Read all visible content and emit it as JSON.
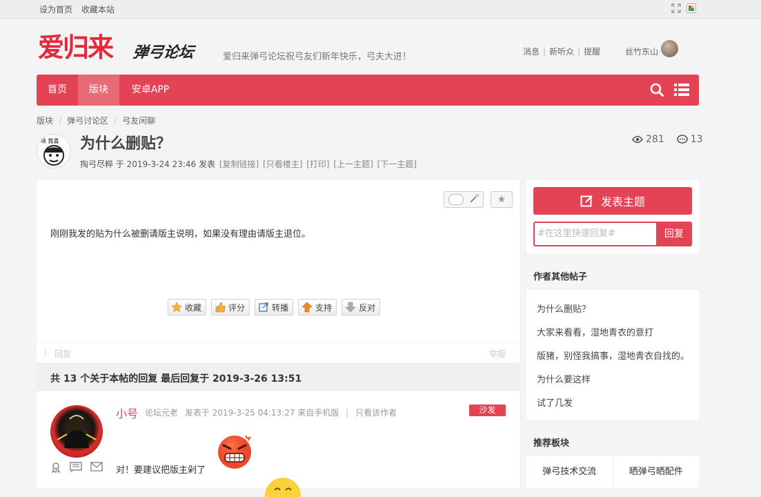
{
  "topbar": {
    "links": [
      "设为首页",
      "收藏本站"
    ]
  },
  "header": {
    "logo_big": "爱归来",
    "logo_script": "弹弓论坛",
    "slogan": "爱归来弹弓论坛祝弓友们新年快乐，弓夫大进！",
    "user_links": [
      "消息",
      "新听众",
      "提醒"
    ],
    "username": "丝竹东山"
  },
  "nav": {
    "items": [
      "首页",
      "版块",
      "安卓APP"
    ],
    "active_index": 1
  },
  "breadcrumb": [
    "版块",
    "弹弓讨论区",
    "弓友闲聊"
  ],
  "thread": {
    "title": "为什么删贴？",
    "author": "掏弓尽粹",
    "posted": "于 2019-3-24 23:46 发表",
    "meta_links": [
      "[复制链接]",
      "[只看楼主]",
      "[打印]",
      "[上一主题]",
      "[下一主题]"
    ],
    "views": "281",
    "replies": "13"
  },
  "post": {
    "body": "刚刚我发的贴为什么被删请版主说明，如果没有理由请版主退位。",
    "actions": [
      "收藏",
      "评分",
      "转播",
      "支持",
      "反对"
    ],
    "foot_reply": "回复",
    "foot_report": "举报"
  },
  "reply_summary": "共 13 个关于本帖的回复 最后回复于 2019-3-26 13:51",
  "reply": {
    "name": "小号",
    "rank": "论坛元老",
    "posted": "发表于 2019-3-25 04:13:27 来自手机版",
    "only_author": "只看该作者",
    "badge": "沙发",
    "text": "对！要建议把版主剁了"
  },
  "sidebar": {
    "new_thread": "发表主题",
    "quick_placeholder": "#在这里快速回复#",
    "quick_button": "回复",
    "other_posts_title": "作者其他帖子",
    "other_posts": [
      "为什么删贴？",
      "大家来看看，湿地青衣的意打",
      "版猪，别怪我搞事，湿地青衣自找的。",
      "为什么要这样",
      "试了几发"
    ],
    "recommend_title": "推荐板块",
    "recommend": [
      "弹弓技术交流",
      "晒弹弓晒配件"
    ]
  },
  "colors": {
    "accent": "#e34354",
    "nav_active": "#e86a77"
  }
}
